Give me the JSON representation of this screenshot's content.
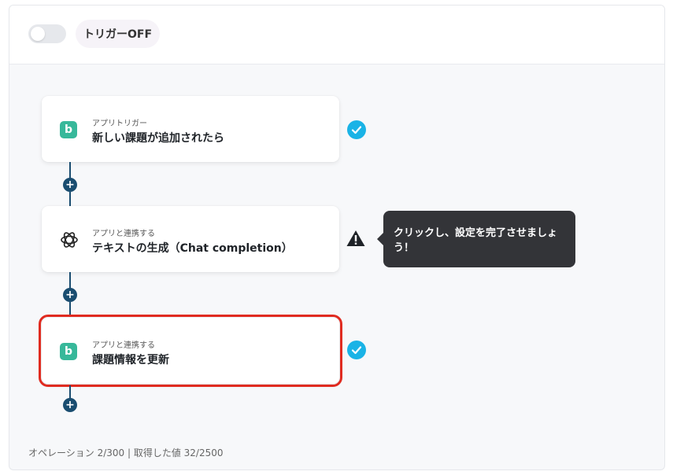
{
  "header": {
    "trigger_label": "トリガーOFF"
  },
  "flow": {
    "steps": [
      {
        "small": "アプリトリガー",
        "title": "新しい課題が追加されたら",
        "icon": "b",
        "status": "check-icon"
      },
      {
        "small": "アプリと連携する",
        "title": "テキストの生成（Chat completion）",
        "icon": "openai-icon",
        "status": "warning-icon"
      },
      {
        "small": "アプリと連携する",
        "title": "課題情報を更新",
        "icon": "b",
        "status": "check-icon"
      }
    ],
    "tooltip": "クリックし、設定を完了させましょう！"
  },
  "footer": {
    "text": "オペレーション 2/300 | 取得した値 32/2500"
  },
  "colors": {
    "accent": "#1ab3e6",
    "connector": "#1a4d70",
    "selected": "#e02b20",
    "app": "#37b89a",
    "tooltip_bg": "#333438"
  }
}
